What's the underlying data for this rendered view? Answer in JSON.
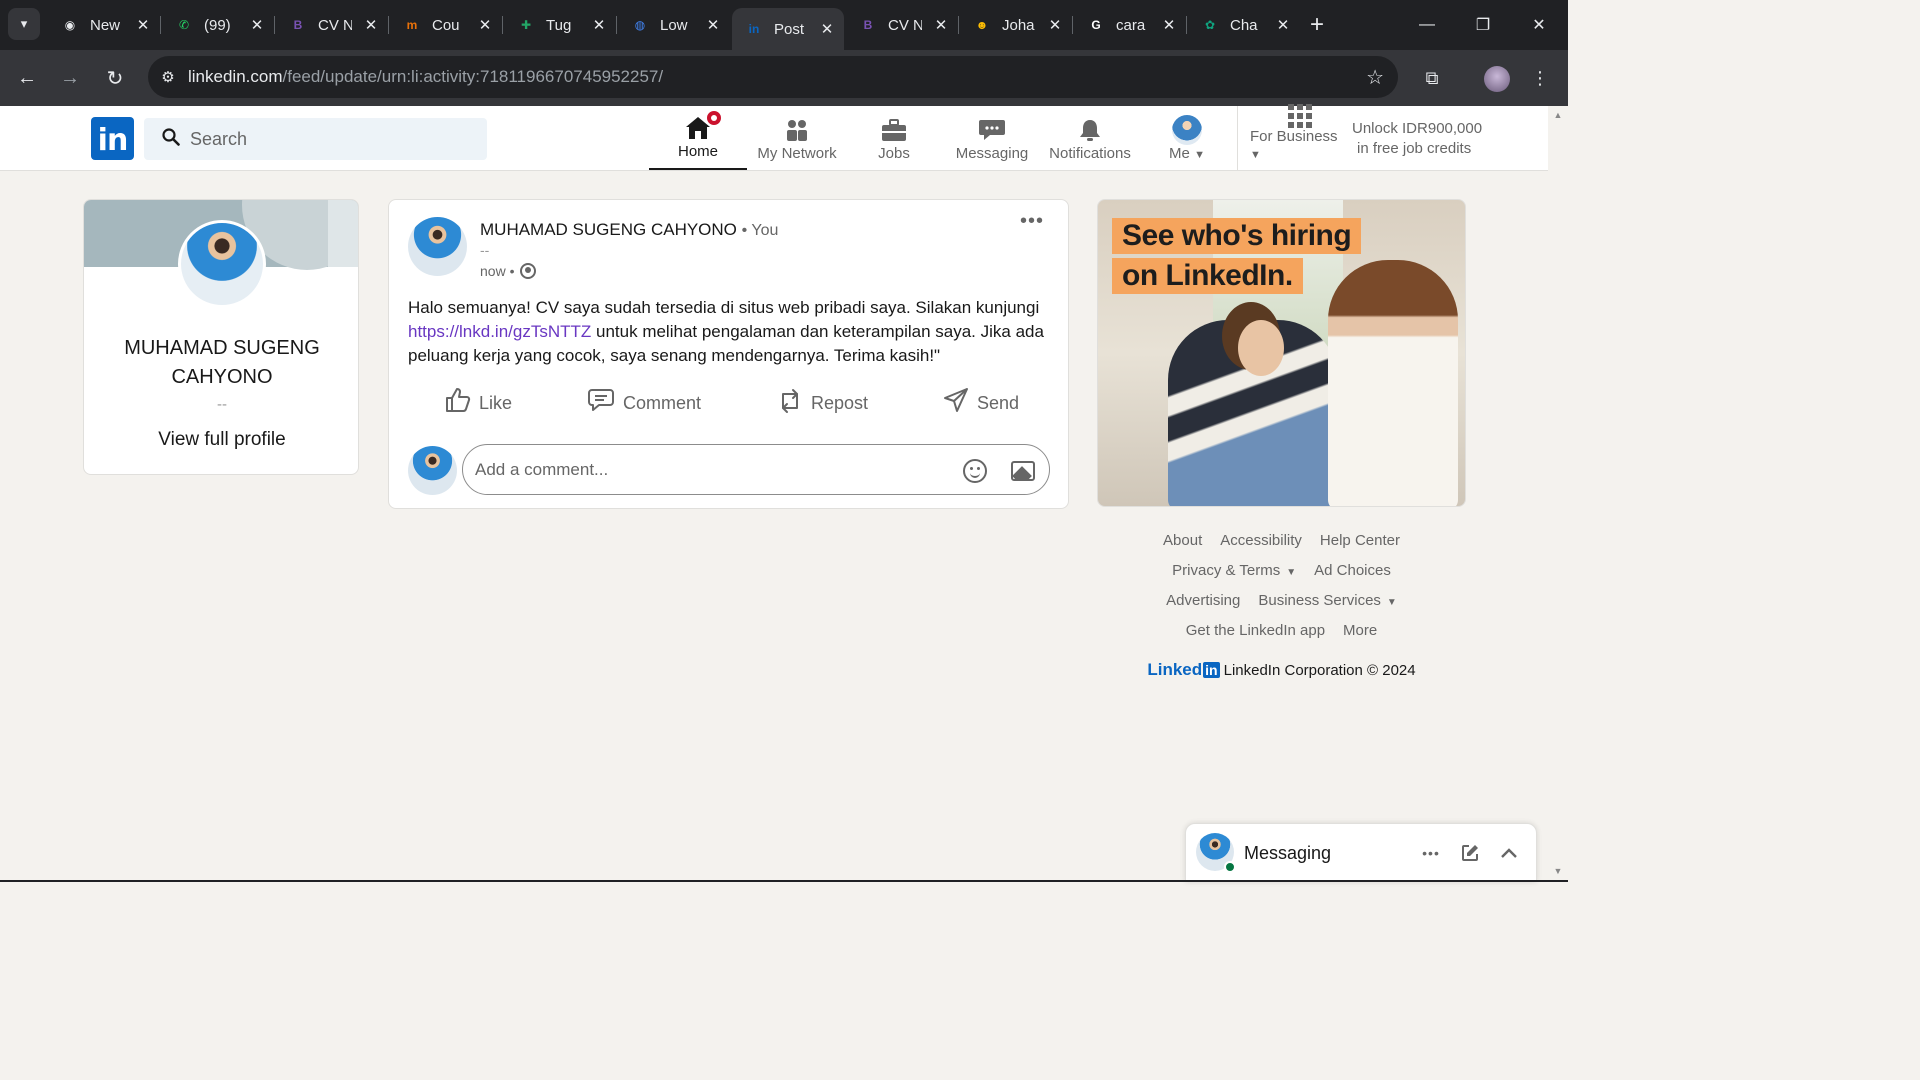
{
  "browser": {
    "tabs": [
      {
        "title": "New",
        "favicon": "chrome-icon",
        "color": "#e8eaed",
        "glyph": "◉"
      },
      {
        "title": "(99)",
        "favicon": "whatsapp-icon",
        "color": "#25d366",
        "glyph": "✆"
      },
      {
        "title": "CV N",
        "favicon": "bootstrap-icon",
        "color": "#7952b3",
        "glyph": "B"
      },
      {
        "title": "Cou",
        "favicon": "mooc-icon",
        "color": "#e8710a",
        "glyph": "m"
      },
      {
        "title": "Tug",
        "favicon": "sheets-icon",
        "color": "#23a566",
        "glyph": "✚"
      },
      {
        "title": "Low",
        "favicon": "globe-icon",
        "color": "#4285f4",
        "glyph": "◍"
      },
      {
        "title": "Post",
        "favicon": "linkedin-icon",
        "color": "#0a66c2",
        "glyph": "in",
        "active": true
      },
      {
        "title": "CV N",
        "favicon": "bootstrap-icon",
        "color": "#7952b3",
        "glyph": "B"
      },
      {
        "title": "Joha",
        "favicon": "emoji-icon",
        "color": "#fbbc04",
        "glyph": "☻"
      },
      {
        "title": "cara",
        "favicon": "google-icon",
        "color": "#ffffff",
        "glyph": "G"
      },
      {
        "title": "Cha",
        "favicon": "chatgpt-icon",
        "color": "#10a37f",
        "glyph": "✿"
      }
    ],
    "url_host": "linkedin.com",
    "url_path": "/feed/update/urn:li:activity:7181196670745952257/"
  },
  "linkedin": {
    "logo_text": "in",
    "search_placeholder": "Search",
    "nav": {
      "home": "Home",
      "network": "My Network",
      "jobs": "Jobs",
      "messaging": "Messaging",
      "notifications": "Notifications",
      "me": "Me",
      "business": "For Business"
    },
    "premium_line1": "Unlock IDR900,000",
    "premium_line2": "in free job credits"
  },
  "profile_card": {
    "name": "MUHAMAD SUGENG CAHYONO",
    "headline": "--",
    "view_profile": "View full profile"
  },
  "post": {
    "author": "MUHAMAD SUGENG CAHYONO",
    "you_label": "• You",
    "subtitle": "--",
    "time": "now •",
    "text_before": "Halo semuanya! CV saya sudah tersedia di situs web pribadi saya. Silakan kunjungi ",
    "link": "https://lnkd.in/gzTsNTTZ",
    "text_after": " untuk melihat pengalaman dan keterampilan saya. Jika ada peluang kerja yang cocok, saya senang mendengarnya. Terima kasih!\"",
    "actions": {
      "like": "Like",
      "comment": "Comment",
      "repost": "Repost",
      "send": "Send"
    },
    "comment_placeholder": "Add a comment..."
  },
  "ad": {
    "line1": "See who's hiring",
    "line2": "on LinkedIn."
  },
  "footer": {
    "about": "About",
    "accessibility": "Accessibility",
    "help": "Help Center",
    "privacy": "Privacy & Terms",
    "ad_choices": "Ad Choices",
    "advertising": "Advertising",
    "business_services": "Business Services",
    "get_app": "Get the LinkedIn app",
    "more": "More",
    "brand_word": "Linked",
    "brand_in": "in",
    "copyright": "LinkedIn Corporation © 2024"
  },
  "messaging_dock": {
    "title": "Messaging"
  },
  "colors": {
    "linkedin_blue": "#0a66c2",
    "notification_red": "#cb112d",
    "link_purple": "#6937c2",
    "ad_orange": "#f5a45d"
  }
}
